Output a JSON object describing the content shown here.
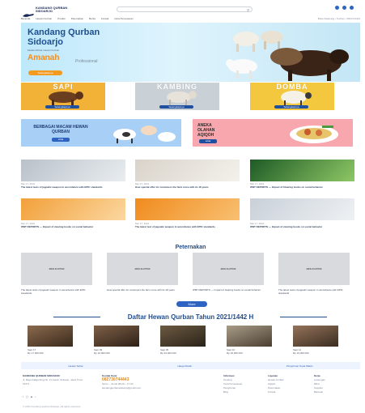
{
  "header": {
    "brand": "KANDANG QURBAN SIDOARJO",
    "search_placeholder": "",
    "nav": [
      "Beranda",
      "Hewan Kurban",
      "Produk",
      "Peternakan",
      "Berita",
      "Kontak",
      "Cara Pemesanan"
    ],
    "nav_right": "Buka Sekarang • Kurban • 0821744443"
  },
  "hero": {
    "title_line1": "Kandang Qurban",
    "title_line2": "Sidoarjo",
    "subtitle": "Melalui Ikhtiar Hewan Kurban",
    "amanah": "Amanah",
    "professional": "Professional",
    "button": "Selengkapnya"
  },
  "categories": [
    {
      "label": "SAPI",
      "pill": "Selengkapnya",
      "color": "#f2b137"
    },
    {
      "label": "KAMBING",
      "pill": "Selengkapnya",
      "color": "#c9d0d6"
    },
    {
      "label": "DOMBA",
      "pill": "Selengkapnya",
      "color": "#f4c83e"
    }
  ],
  "promos": [
    {
      "title": "BERBAGAI MACAM HEWAN QURBAN",
      "button": "Lihat",
      "bg": "#a8cff6"
    },
    {
      "title": "ANEKA OLAHAN AQIQOH",
      "button": "Lihat",
      "bg": "#f7a7ad"
    }
  ],
  "news": [
    {
      "date": "Mei 17, 2021",
      "title": "The latest tests of jagoatic weapon in accordance with EPIC standards"
    },
    {
      "date": "Mei 17, 2021",
      "title": "How special offer for customers the farm more with its 18 years"
    },
    {
      "date": "Mei 17, 2021",
      "title": "IPBT REPORTS — Impact of Clearing books on social behavior"
    },
    {
      "date": "Mei 17, 2021",
      "title": "IPBT REPORTS — Impact of clearing books on social behavior"
    },
    {
      "date": "Mei 17, 2021",
      "title": "The latest test of jagoatic weapon in accordance with EPIC standards"
    },
    {
      "date": "Mei 17, 2021",
      "title": "IPBT REPORTS — Impact of clearing books on social behavior"
    }
  ],
  "peternakan": {
    "title": "Peternakan",
    "items": [
      {
        "placeholder": "BKS.KJ.P500",
        "caption": "The latest tests of jagoatic weapon in accordance with EPIC standards"
      },
      {
        "placeholder": "BKS.KJ.P500",
        "caption": "How special offer for customers the farm more with its 18 years"
      },
      {
        "placeholder": "BKS.KJ.P500",
        "caption": "IPBT REPORTS — Impact of clearing books on social behavior"
      },
      {
        "placeholder": "BKS.KJ.P500",
        "caption": "The latest tests of jagoatic weapon in accordance with EPIC standards"
      }
    ],
    "more": "More"
  },
  "daftar": {
    "title": "Daftar Hewan Qurban Tahun 2021/1442 H",
    "animals": [
      {
        "name": "Sapi 17",
        "price": "Rp 17.000.000"
      },
      {
        "name": "Sapi 09",
        "price": "Rp 16.000.000"
      },
      {
        "name": "Sapi 05",
        "price": "Rp 23.000.000"
      },
      {
        "name": "Sapi 10",
        "price": "Rp 18.000.000"
      },
      {
        "name": "Sapi 11",
        "price": "Rp 19.000.000"
      }
    ]
  },
  "strip": [
    "Hewan Sehat",
    "Harga Murah",
    "Pengiriman Tepat Waktu"
  ],
  "footer": {
    "brand": "KANDANG QURBAN SIDOARJO",
    "address": "Jl. Raya Kaligunting No. 11 Candi, Sidoarjo, Jawa Timur 61271",
    "contact_title": "Kontak Kami",
    "phone": "082730744443",
    "hours": "Senin – Jumat 08.00 – 17.00",
    "email": "kandangqurbansidoarjo@gmail.com",
    "cols": [
      {
        "title": "Informasi",
        "items": [
          "Tentang",
          "Cara Pemesanan",
          "Pengiriman",
          "Blog"
        ]
      },
      {
        "title": "Layanan",
        "items": [
          "Hewan Kurban",
          "Aqiqoh",
          "Peternakan",
          "Kontak"
        ]
      },
      {
        "title": "Kerja",
        "items": [
          "Lowongan",
          "Mitra",
          "Supplier",
          "Bantuan"
        ]
      }
    ],
    "copyright": "© 2021 Kandang Qurban Sidoarjo. All rights reserved."
  },
  "colors": {
    "primary": "#1f4f9f",
    "accent": "#f39b21",
    "hero_bg": "#cdeefb"
  }
}
